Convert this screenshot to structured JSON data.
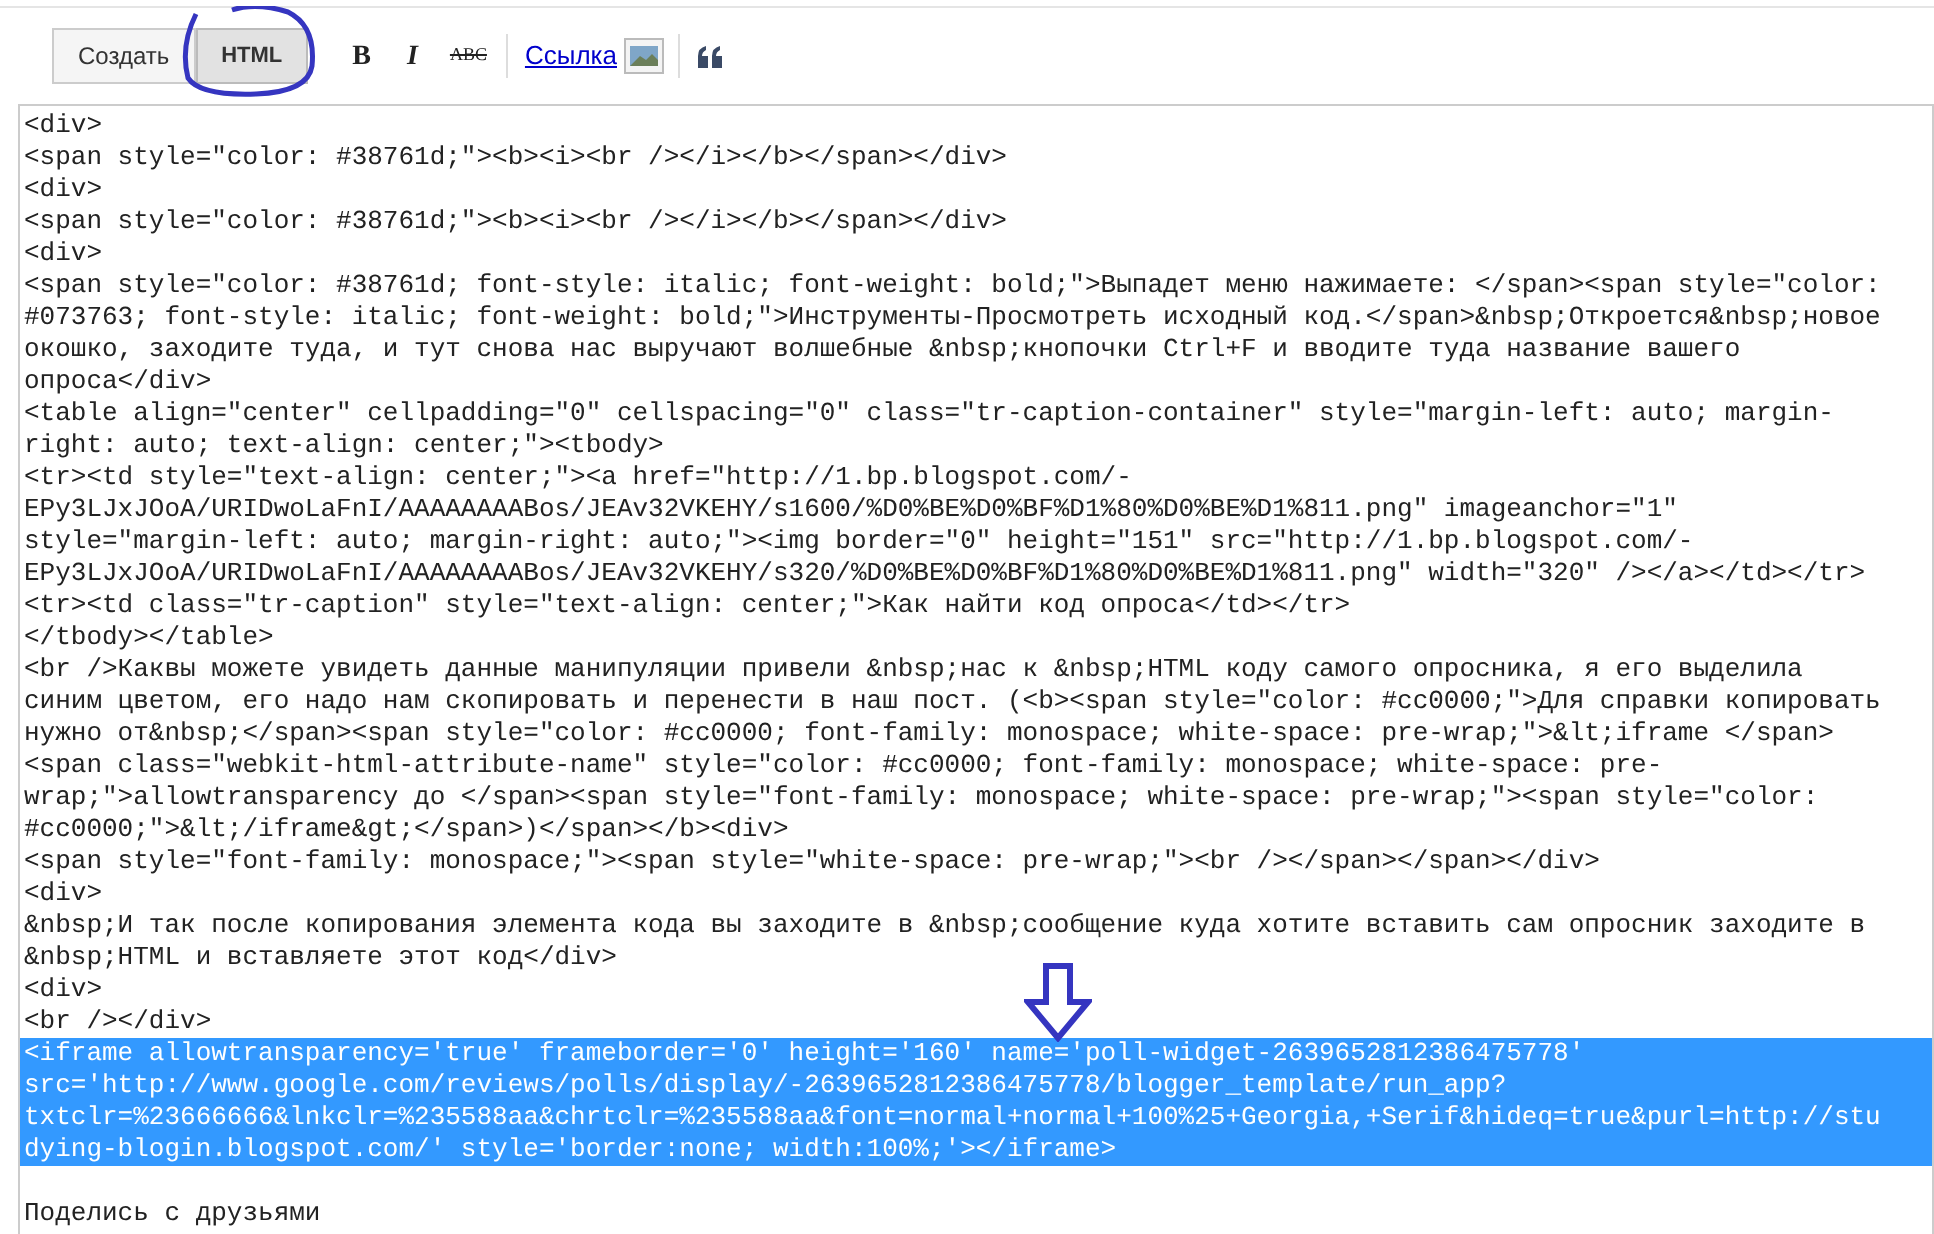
{
  "toolbar": {
    "mode_tabs": [
      {
        "label": "Создать",
        "selected": false
      },
      {
        "label": "HTML",
        "selected": true
      }
    ],
    "format_buttons": [
      {
        "kind": "bold",
        "label": "B"
      },
      {
        "kind": "italic",
        "label": "I"
      },
      {
        "kind": "strike",
        "label": "ABC"
      }
    ],
    "link": "Ссылка"
  },
  "editor": {
    "blocks": [
      {
        "kind": "code",
        "selected": false,
        "lines": [
          "<div>",
          "<span style=\"color: #38761d;\"><b><i><br /></i></b></span></div>",
          "<div>",
          "<span style=\"color: #38761d;\"><b><i><br /></i></b></span></div>",
          "<div>",
          "<span style=\"color: #38761d; font-style: italic; font-weight: bold;\">Выпадет меню нажимаете: </span><span style=\"color:",
          "#073763; font-style: italic; font-weight: bold;\">Инструменты-Просмотреть исходный код.</span>&nbsp;Откроется&nbsp;новое",
          "окошко, заходите туда, и тут снова нас выручают волшебные &nbsp;кнопочки Ctrl+F и вводите туда название вашего",
          "опроса</div>",
          "<table align=\"center\" cellpadding=\"0\" cellspacing=\"0\" class=\"tr-caption-container\" style=\"margin-left: auto; margin-",
          "right: auto; text-align: center;\"><tbody>",
          "<tr><td style=\"text-align: center;\"><a href=\"http://1.bp.blogspot.com/-",
          "EPy3LJxJOoA/URIDwoLaFnI/AAAAAAAABos/JEAv32VKEHY/s1600/%D0%BE%D0%BF%D1%80%D0%BE%D1%811.png\" imageanchor=\"1\"",
          "style=\"margin-left: auto; margin-right: auto;\"><img border=\"0\" height=\"151\" src=\"http://1.bp.blogspot.com/-",
          "EPy3LJxJOoA/URIDwoLaFnI/AAAAAAAABos/JEAv32VKEHY/s320/%D0%BE%D0%BF%D1%80%D0%BE%D1%811.png\" width=\"320\" /></a></td></tr>",
          "<tr><td class=\"tr-caption\" style=\"text-align: center;\">Как найти код опроса</td></tr>",
          "</tbody></table>",
          "<br />Каквы можете увидеть данные манипуляции привели &nbsp;нас к &nbsp;HTML коду самого опросника, я его выделила",
          "синим цветом, его надо нам скопировать и перенести в наш пост. (<b><span style=\"color: #cc0000;\">Для справки копировать",
          "нужно от&nbsp;</span><span style=\"color: #cc0000; font-family: monospace; white-space: pre-wrap;\">&lt;iframe </span>",
          "<span class=\"webkit-html-attribute-name\" style=\"color: #cc0000; font-family: monospace; white-space: pre-",
          "wrap;\">allowtransparency до </span><span style=\"font-family: monospace; white-space: pre-wrap;\"><span style=\"color:",
          "#cc0000;\">&lt;/iframe&gt;</span>)</span></b><div>",
          "<span style=\"font-family: monospace;\"><span style=\"white-space: pre-wrap;\"><br /></span></span></div>",
          "<div>",
          "&nbsp;И так после копирования элемента кода вы заходите в &nbsp;сообщение куда хотите вставить сам опросник заходите в",
          "&nbsp;HTML и вставляете этот код</div>",
          "<div>",
          "<br /></div>"
        ]
      },
      {
        "kind": "code",
        "selected": true,
        "lines": [
          "<iframe allowtransparency='true' frameborder='0' height='160' name='poll-widget-2639652812386475778'",
          "src='http://www.google.com/reviews/polls/display/-2639652812386475778/blogger_template/run_app?",
          "txtclr=%23666666&lnkclr=%235588aa&chrtclr=%235588aa&font=normal+normal+100%25+Georgia,+Serif&hideq=true&purl=http://stu",
          "dying-blogin.blogspot.com/' style='border:none; width:100%;'></iframe>"
        ]
      },
      {
        "kind": "blank"
      },
      {
        "kind": "code",
        "selected": false,
        "lines": [
          "Поделись с друзьями"
        ]
      }
    ]
  }
}
